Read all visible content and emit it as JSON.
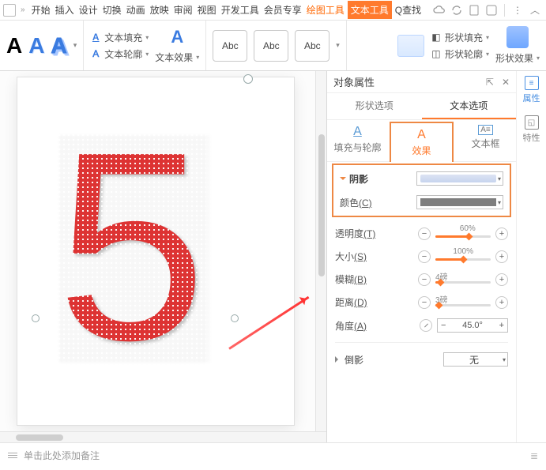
{
  "menu": {
    "items": [
      "开始",
      "插入",
      "设计",
      "切换",
      "动画",
      "放映",
      "审阅",
      "视图",
      "开发工具",
      "会员专享"
    ],
    "drawing_tools": "绘图工具",
    "text_tools": "文本工具",
    "search": "查找",
    "search_prefix": "Q"
  },
  "ribbon": {
    "text_fill": "文本填充",
    "text_outline": "文本轮廓",
    "text_effect": "文本效果",
    "abc": "Abc",
    "shape_fill": "形状填充",
    "shape_outline": "形状轮廓",
    "shape_effect": "形状效果"
  },
  "canvas": {
    "glyph": "5"
  },
  "panel": {
    "title": "对象属性",
    "tabs": {
      "shape": "形状选项",
      "text": "文本选项"
    },
    "subtabs": {
      "fill_outline": "填充与轮廓",
      "effects": "效果",
      "textbox": "文本框"
    },
    "shadow": {
      "header": "阴影",
      "color_label": "颜色",
      "color_key": "(C)",
      "transparency_label": "透明度",
      "transparency_key": "(T)",
      "transparency_value": "60%",
      "size_label": "大小",
      "size_key": "(S)",
      "size_value": "100%",
      "blur_label": "模糊",
      "blur_key": "(B)",
      "blur_value": "4磅",
      "distance_label": "距离",
      "distance_key": "(D)",
      "distance_value": "3磅",
      "angle_label": "角度",
      "angle_key": "(A)",
      "angle_value": "45.0°"
    },
    "reflection": {
      "header": "倒影",
      "value": "无"
    },
    "rail": {
      "properties": "属性",
      "features": "特性"
    }
  },
  "notes": {
    "placeholder": "单击此处添加备注"
  }
}
